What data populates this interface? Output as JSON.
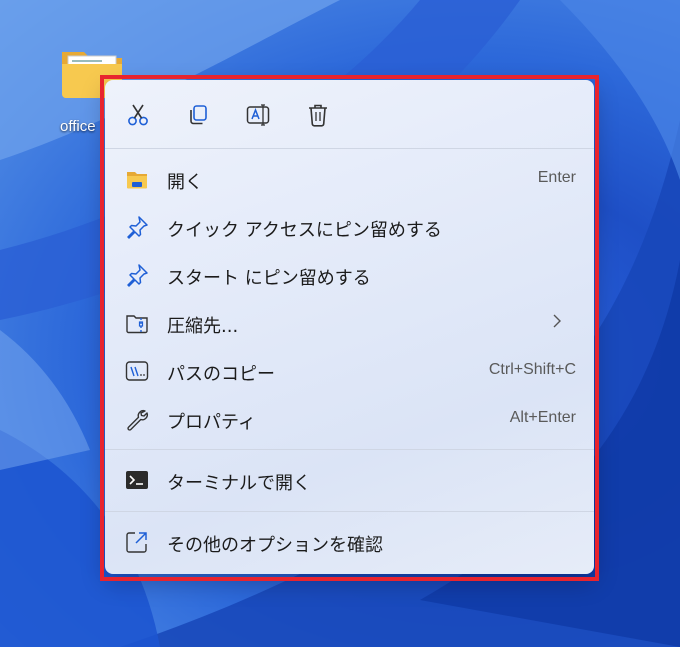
{
  "desktop": {
    "folder_label": "office"
  },
  "colors": {
    "frame": "#e8242e",
    "menu_bg": "#e3eaf9",
    "icon_blue": "#1e5fd6"
  },
  "toolbar": {
    "buttons": [
      {
        "name": "cut",
        "icon": "scissors-icon"
      },
      {
        "name": "copy",
        "icon": "copy-icon"
      },
      {
        "name": "rename",
        "icon": "rename-icon"
      },
      {
        "name": "delete",
        "icon": "trash-icon"
      }
    ]
  },
  "menu": {
    "items": [
      {
        "label": "開く",
        "accel": "Enter",
        "icon": "folder-icon"
      },
      {
        "label": "クイック アクセスにピン留めする",
        "accel": "",
        "icon": "pin-icon"
      },
      {
        "label": "スタート にピン留めする",
        "accel": "",
        "icon": "pin-icon"
      },
      {
        "label": "圧縮先...",
        "accel": "",
        "icon": "zip-folder-icon",
        "submenu": true
      },
      {
        "label": "パスのコピー",
        "accel": "Ctrl+Shift+C",
        "icon": "path-copy-icon"
      },
      {
        "label": "プロパティ",
        "accel": "Alt+Enter",
        "icon": "wrench-icon"
      },
      {
        "label": "ターミナルで開く",
        "accel": "",
        "icon": "terminal-icon"
      },
      {
        "label": "その他のオプションを確認",
        "accel": "",
        "icon": "more-options-icon"
      }
    ]
  }
}
